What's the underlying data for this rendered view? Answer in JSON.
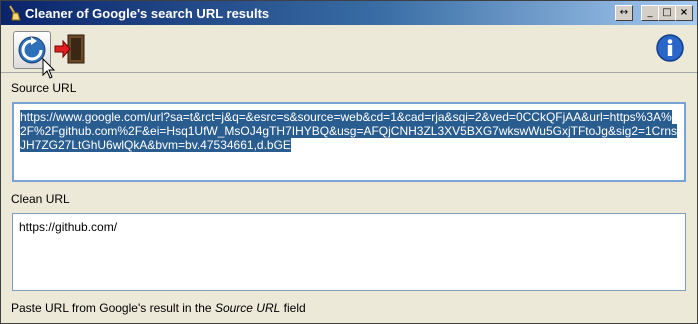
{
  "window": {
    "title": "Cleaner of Google's search URL results",
    "controls": {
      "restore_glyph": "↔",
      "minimize_glyph": "_",
      "maximize_glyph": "□",
      "close_glyph": "×"
    }
  },
  "toolbar": {
    "refresh_icon": "refresh-icon",
    "exit_icon": "exit-door-icon",
    "info_icon": "info-icon"
  },
  "source": {
    "label": "Source URL",
    "value": "https://www.google.com/url?sa=t&rct=j&q=&esrc=s&source=web&cd=1&cad=rja&sqi=2&ved=0CCkQFjAA&url=https%3A%2F%2Fgithub.com%2F&ei=Hsq1UfW_MsOJ4gTH7IHYBQ&usg=AFQjCNH3ZL3XV5BXG7wkswWu5GxjTFtoJg&sig2=1CrnsJH7ZG27LtGhU6wlQkA&bvm=bv.47534661,d.bGE"
  },
  "clean": {
    "label": "Clean URL",
    "value": "https://github.com/"
  },
  "status": {
    "prefix": "Paste URL from Google's result in the ",
    "emphasis": "Source URL",
    "suffix": " field"
  },
  "colors": {
    "selection": "#2a5d8f",
    "titlebar_start": "#0a246a",
    "titlebar_end": "#a6caf0"
  }
}
